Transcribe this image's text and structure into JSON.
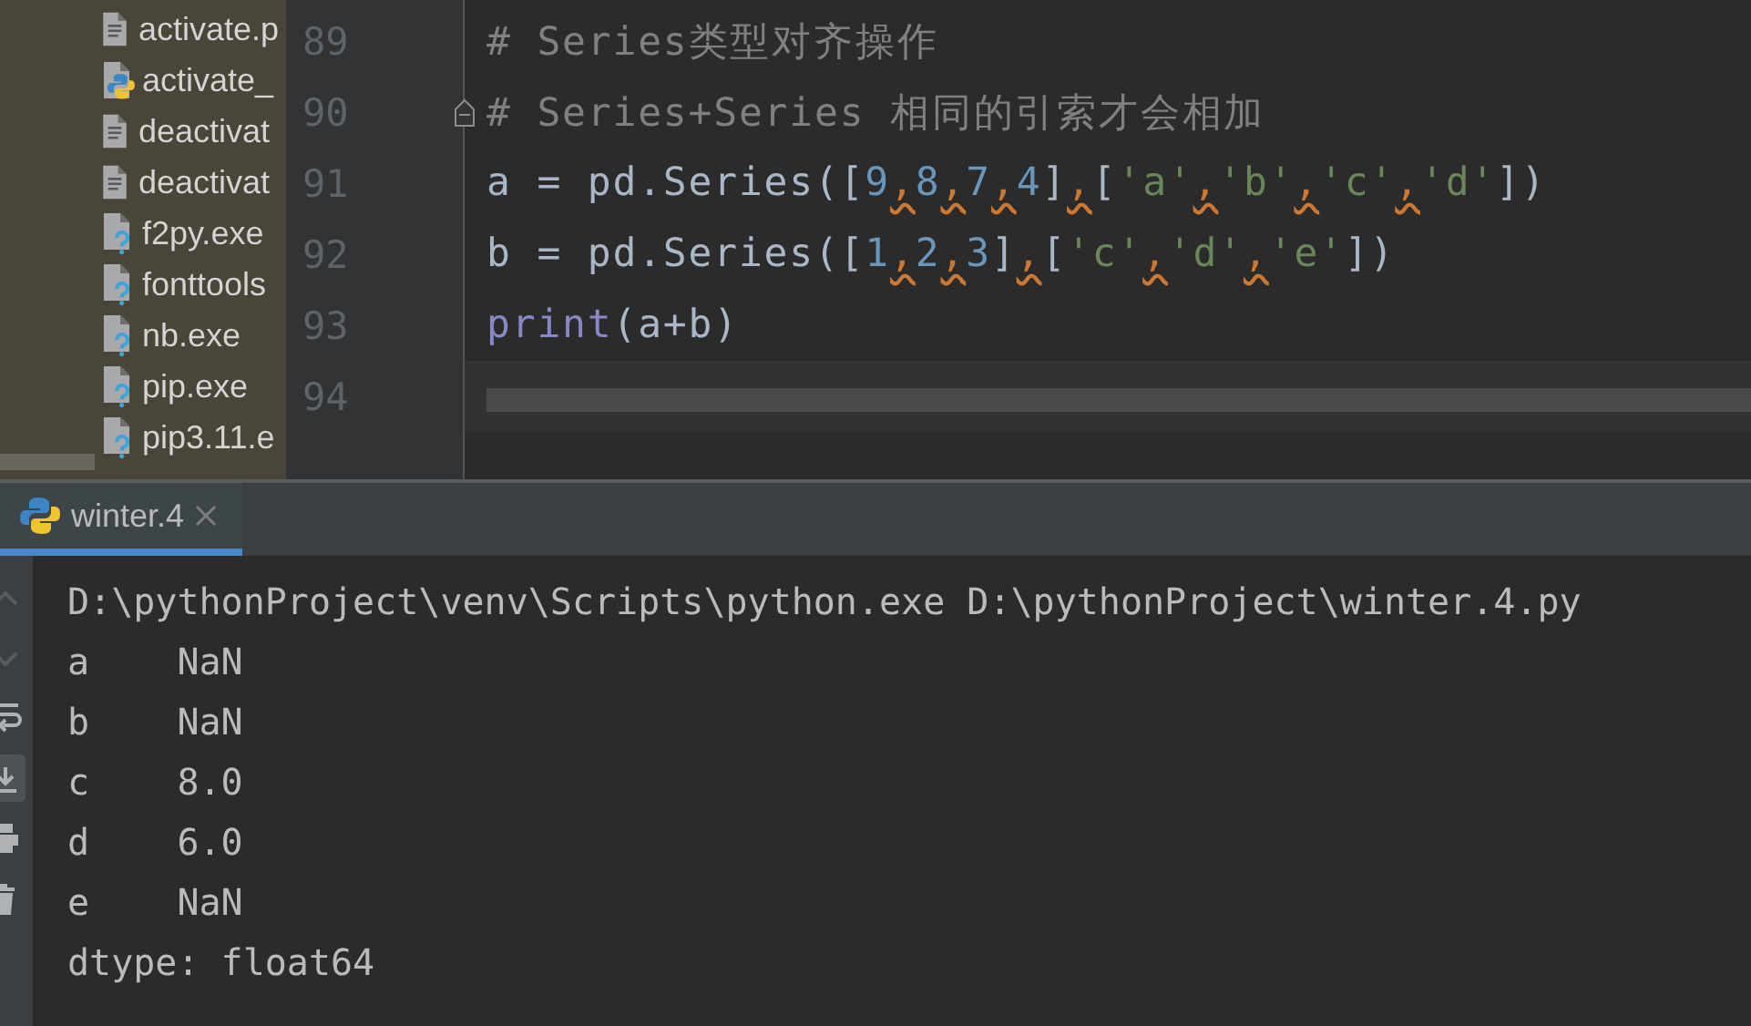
{
  "project_tree": {
    "items": [
      {
        "label": "activate.p",
        "kind": "text"
      },
      {
        "label": "activate_",
        "kind": "python"
      },
      {
        "label": "deactivat",
        "kind": "text"
      },
      {
        "label": "deactivat",
        "kind": "text"
      },
      {
        "label": "f2py.exe",
        "kind": "unknown"
      },
      {
        "label": "fonttools",
        "kind": "unknown"
      },
      {
        "label": "nb.exe",
        "kind": "unknown"
      },
      {
        "label": "pip.exe",
        "kind": "unknown"
      },
      {
        "label": "pip3.11.e",
        "kind": "unknown"
      }
    ]
  },
  "editor": {
    "lines": [
      {
        "number": "89",
        "current": false,
        "fold": false,
        "tokens": [
          {
            "text": "# Series类型对齐操作",
            "kind": "comment"
          }
        ]
      },
      {
        "number": "90",
        "current": false,
        "fold": true,
        "tokens": [
          {
            "text": "# Series+Series 相同的引索才会相加",
            "kind": "comment"
          }
        ]
      },
      {
        "number": "91",
        "current": false,
        "fold": false,
        "tokens": [
          {
            "text": "a = pd.Series([",
            "kind": "plain"
          },
          {
            "text": "9",
            "kind": "number"
          },
          {
            "text": ",",
            "kind": "warn"
          },
          {
            "text": "8",
            "kind": "number"
          },
          {
            "text": ",",
            "kind": "warn"
          },
          {
            "text": "7",
            "kind": "number"
          },
          {
            "text": ",",
            "kind": "warn"
          },
          {
            "text": "4",
            "kind": "number"
          },
          {
            "text": "]",
            "kind": "plain"
          },
          {
            "text": ",",
            "kind": "warn"
          },
          {
            "text": "[",
            "kind": "plain"
          },
          {
            "text": "'a'",
            "kind": "string"
          },
          {
            "text": ",",
            "kind": "warn"
          },
          {
            "text": "'b'",
            "kind": "string"
          },
          {
            "text": ",",
            "kind": "warn"
          },
          {
            "text": "'c'",
            "kind": "string"
          },
          {
            "text": ",",
            "kind": "warn"
          },
          {
            "text": "'d'",
            "kind": "string"
          },
          {
            "text": "])",
            "kind": "plain"
          }
        ]
      },
      {
        "number": "92",
        "current": false,
        "fold": false,
        "tokens": [
          {
            "text": "b = pd.Series([",
            "kind": "plain"
          },
          {
            "text": "1",
            "kind": "number"
          },
          {
            "text": ",",
            "kind": "warn"
          },
          {
            "text": "2",
            "kind": "number"
          },
          {
            "text": ",",
            "kind": "warn"
          },
          {
            "text": "3",
            "kind": "number"
          },
          {
            "text": "]",
            "kind": "plain"
          },
          {
            "text": ",",
            "kind": "warn"
          },
          {
            "text": "[",
            "kind": "plain"
          },
          {
            "text": "'c'",
            "kind": "string"
          },
          {
            "text": ",",
            "kind": "warn"
          },
          {
            "text": "'d'",
            "kind": "string"
          },
          {
            "text": ",",
            "kind": "warn"
          },
          {
            "text": "'e'",
            "kind": "string"
          },
          {
            "text": "])",
            "kind": "plain"
          }
        ]
      },
      {
        "number": "93",
        "current": false,
        "fold": false,
        "tokens": [
          {
            "text": "print",
            "kind": "builtin"
          },
          {
            "text": "(a+b)",
            "kind": "plain"
          }
        ]
      },
      {
        "number": "94",
        "current": true,
        "fold": false
      }
    ]
  },
  "run_panel": {
    "tabs": [
      {
        "label": "winter.4",
        "selected": true
      }
    ],
    "tools": [
      {
        "kind": "up",
        "disabled": true,
        "on": false
      },
      {
        "kind": "down",
        "disabled": true,
        "on": false
      },
      {
        "kind": "wrap",
        "disabled": false,
        "on": false
      },
      {
        "kind": "scroll-end",
        "disabled": false,
        "on": true
      },
      {
        "kind": "print",
        "disabled": false,
        "on": false
      },
      {
        "kind": "trash",
        "disabled": false,
        "on": false
      }
    ],
    "output": [
      "D:\\pythonProject\\venv\\Scripts\\python.exe D:\\pythonProject\\winter.4.py",
      "a    NaN",
      "b    NaN",
      "c    8.0",
      "d    6.0",
      "e    NaN",
      "dtype: float64"
    ]
  }
}
